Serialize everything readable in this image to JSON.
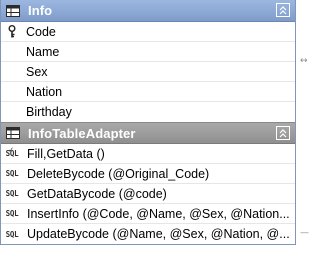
{
  "info_table": {
    "title": "Info",
    "icon": "table-icon",
    "collapse_icon": "collapse-up-icon",
    "primary_key_icon": "key-icon",
    "columns": [
      "Code",
      "Name",
      "Sex",
      "Nation",
      "Birthday"
    ]
  },
  "adapter": {
    "title": "InfoTableAdapter",
    "icon": "table-adapter-icon",
    "collapse_icon": "collapse-up-icon",
    "query_icon_text": "SQL",
    "queries": [
      "Fill,GetData ()",
      "DeleteBycode (@Original_Code)",
      "GetDataBycode (@code)",
      "InsertInfo (@Code, @Name, @Sex, @Nation...",
      "UpdateBycode (@Name, @Sex, @Nation, @..."
    ]
  },
  "side_marks": {
    "top": "↔",
    "bottom": "—"
  }
}
